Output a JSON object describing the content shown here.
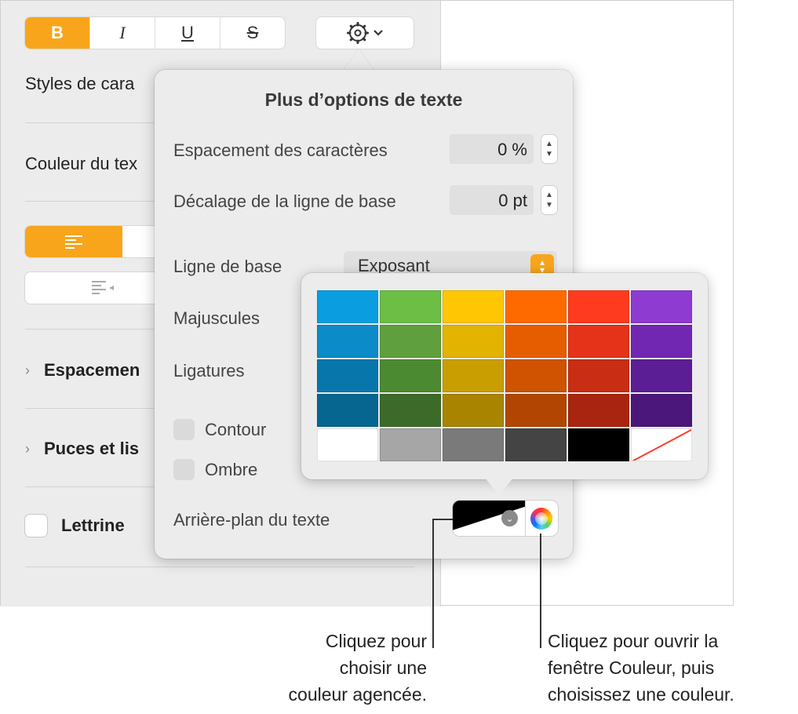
{
  "toolbar": {
    "bold": "B",
    "italic": "I",
    "underline": "U",
    "strikethrough": "S",
    "gear_icon": "gear-icon",
    "chevron_icon": "chevron-down-icon"
  },
  "sidebar": {
    "char_styles_label": "Styles de cara",
    "text_color_label": "Couleur du tex",
    "spacing_label": "Espacemen",
    "bullets_label": "Puces et lis",
    "dropcap_label": "Lettrine"
  },
  "popover": {
    "title": "Plus d’options de texte",
    "char_spacing_label": "Espacement des caractères",
    "char_spacing_value": "0 %",
    "baseline_shift_label": "Décalage de la ligne de base",
    "baseline_shift_value": "0 pt",
    "baseline_label": "Ligne de base",
    "baseline_value": "Exposant",
    "caps_label": "Majuscules",
    "ligatures_label": "Ligatures",
    "outline_label": "Contour",
    "shadow_label": "Ombre",
    "text_bg_label": "Arrière-plan du texte"
  },
  "palette": {
    "colors": [
      "#0a9ee0",
      "#6cbe45",
      "#fec603",
      "#fe6a00",
      "#fe3b1f",
      "#8d3bd1",
      "#0b8bc8",
      "#5fa03d",
      "#e2b300",
      "#e65d00",
      "#e43318",
      "#7227b3",
      "#0777ab",
      "#4c8a32",
      "#c99e00",
      "#cf5300",
      "#c92d14",
      "#5c1e94",
      "#076690",
      "#3c6b29",
      "#a88400",
      "#b24600",
      "#a9250f",
      "#4b177a",
      "#ffffff",
      "#a6a6a6",
      "#7a7a7a",
      "#444444",
      "#000000",
      "none"
    ]
  },
  "callouts": {
    "left_lines": [
      "Cliquez pour",
      "choisir une",
      "couleur agencée."
    ],
    "right_lines": [
      "Cliquez pour ouvrir la",
      "fenêtre Couleur, puis",
      "choisissez une couleur."
    ]
  },
  "accent_color": "#f8a51c"
}
